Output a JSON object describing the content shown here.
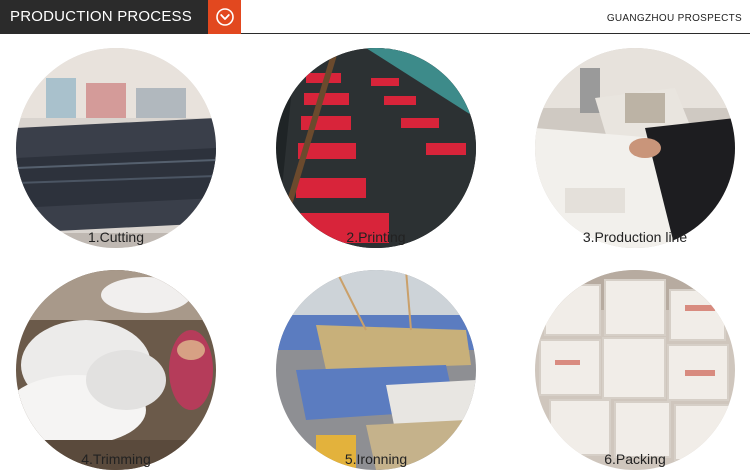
{
  "header": {
    "title": "PRODUCTION PROCESS",
    "brand": "GUANGZHOU PROSPECTS",
    "accent_color": "#e2481f",
    "badge_icon": "chevron-down-circle-icon"
  },
  "steps": [
    {
      "label": "1.Cutting",
      "photo": "fabric-cutting-table-photo"
    },
    {
      "label": "2.Printing",
      "photo": "screen-printing-line-photo"
    },
    {
      "label": "3.Production line",
      "photo": "sewing-machine-photo"
    },
    {
      "label": "4.Trimming",
      "photo": "trimming-garments-photo"
    },
    {
      "label": "5.Ironning",
      "photo": "ironing-table-photo"
    },
    {
      "label": "6.Packing",
      "photo": "packed-bags-photo"
    }
  ]
}
